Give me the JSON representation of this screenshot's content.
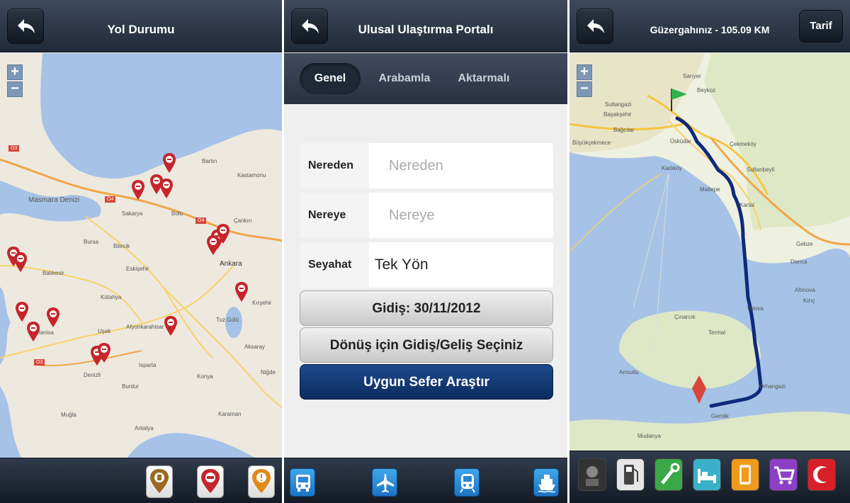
{
  "screen1": {
    "title": "Yol Durumu",
    "back_icon": "back-arrow-icon",
    "zoom_in": "+",
    "zoom_out": "−",
    "map_labels": [
      "Masmara Denizi",
      "Sakarya",
      "Bolu",
      "Bartın",
      "Kastamonu",
      "Çankırı",
      "Ankara",
      "Bilecik",
      "Eskişehir",
      "Bursa",
      "Balıkesir",
      "Manisa",
      "Uşak",
      "Afyonkarahisar",
      "Kütahya",
      "Denizli",
      "Burdur",
      "Isparta",
      "Konya",
      "Aksaray",
      "Tuz Gölü",
      "Kırşehir",
      "Karaman",
      "Muğla",
      "Antalya",
      "Niğde"
    ],
    "road_labels": [
      "O3",
      "O4",
      "O4",
      "O3"
    ],
    "legend_icons": [
      "roadwork-pin-icon",
      "closure-pin-icon",
      "warning-pin-icon"
    ]
  },
  "screen2": {
    "title": "Ulusal Ulaştırma Portalı",
    "back_icon": "back-arrow-icon",
    "tabs": [
      {
        "label": "Genel"
      },
      {
        "label": "Arabamla"
      },
      {
        "label": "Aktarmalı"
      }
    ],
    "from": {
      "label": "Nereden",
      "placeholder": "Nereden"
    },
    "to": {
      "label": "Nereye",
      "placeholder": "Nereye"
    },
    "trip": {
      "label": "Seyahat",
      "value": "Tek Yön"
    },
    "depart_button": "Gidiş: 30/11/2012",
    "return_button": "Dönüş için Gidiş/Geliş Seçiniz",
    "search_button": "Uygun Sefer Araştır",
    "modes": [
      "bus-icon",
      "plane-icon",
      "train-icon",
      "ship-icon"
    ]
  },
  "screen3": {
    "title": "Güzergahınız - 105.09 KM",
    "tarif_button": "Tarif",
    "back_icon": "back-arrow-icon",
    "zoom_in": "+",
    "zoom_out": "−",
    "map_labels": [
      "Sarıyer",
      "Beykoz",
      "Sultangazi",
      "Başakşehir",
      "Bağcılar",
      "Üsküdar",
      "Kadıköy",
      "Çekmeköy",
      "Maltepe",
      "Kartal",
      "Sultanbeyli",
      "Gebze",
      "Darıca",
      "Yalova",
      "Çınarcık",
      "Termal",
      "Altınova",
      "Armutlu",
      "Orhangazi",
      "Gemlik",
      "Mudanya",
      "Kırıç",
      "Büyükçekmece"
    ],
    "poi_icons": [
      {
        "name": "photo-icon",
        "color": "#333333"
      },
      {
        "name": "fuel-icon",
        "color": "#e6e6e6"
      },
      {
        "name": "repair-icon",
        "color": "#3aa846"
      },
      {
        "name": "hotel-icon",
        "color": "#3bb0c9"
      },
      {
        "name": "info-icon",
        "color": "#f09a1c"
      },
      {
        "name": "shopping-cart-icon",
        "color": "#8c3fc7"
      },
      {
        "name": "crescent-icon",
        "color": "#d8202a"
      }
    ]
  }
}
